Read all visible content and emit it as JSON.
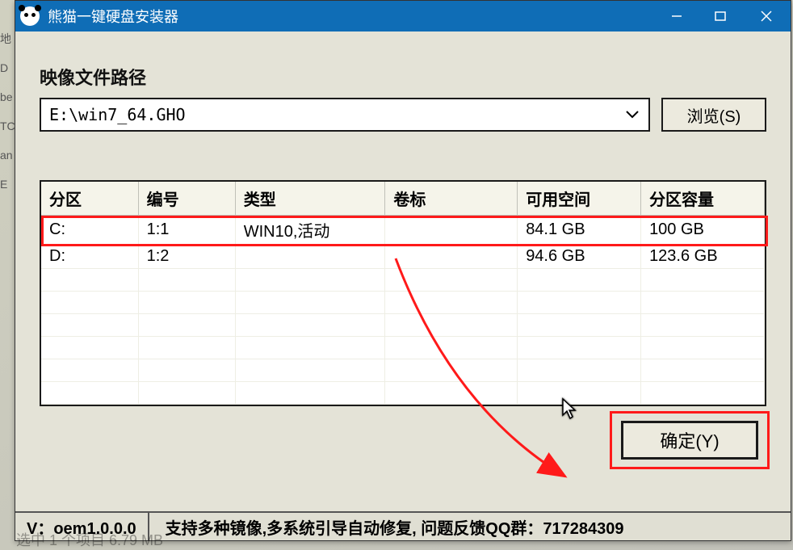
{
  "window": {
    "title": "熊猫一键硬盘安装器"
  },
  "path_section": {
    "label": "映像文件路径",
    "value": "E:\\win7_64.GHO",
    "browse_label": "浏览(S)"
  },
  "grid": {
    "headers": {
      "drive": "分区",
      "number": "编号",
      "type": "类型",
      "label": "卷标",
      "free": "可用空间",
      "capacity": "分区容量"
    },
    "rows": [
      {
        "drive": "C:",
        "number": "1:1",
        "type": "WIN10,活动",
        "label": "",
        "free": "84.1 GB",
        "capacity": "100 GB"
      },
      {
        "drive": "D:",
        "number": "1:2",
        "type": "",
        "label": "",
        "free": "94.6 GB",
        "capacity": "123.6 GB"
      }
    ]
  },
  "buttons": {
    "confirm": "确定(Y)"
  },
  "status": {
    "version": "V：oem1.0.0.0",
    "support": "支持多种镜像,多系统引导自动修复, 问题反馈QQ群：717284309"
  },
  "bg_hint": "选中 1 个项目  6.79 MB",
  "colors": {
    "accent": "#0f6db6",
    "annotation": "#ff1a1a"
  }
}
